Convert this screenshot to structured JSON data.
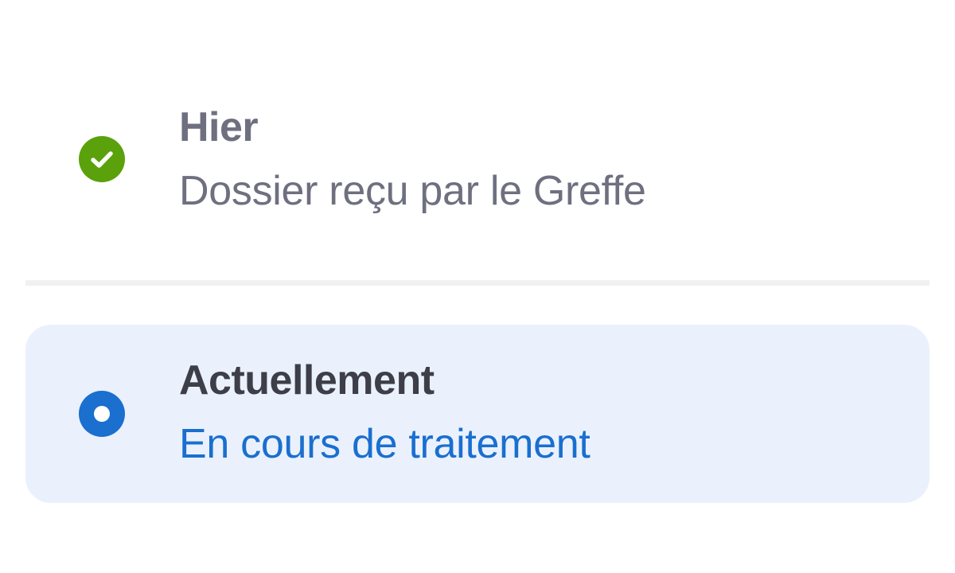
{
  "colors": {
    "done_accent": "#5aa10c",
    "current_accent": "#1a6fcf",
    "current_background": "#eaf1fc",
    "muted_text": "#6e7080",
    "strong_text": "#3d3e48",
    "divider": "#f1f1f3"
  },
  "timeline": {
    "steps": [
      {
        "state": "done",
        "icon": "check-circle-icon",
        "heading": "Hier",
        "detail": "Dossier reçu par le Greffe"
      },
      {
        "state": "current",
        "icon": "radio-dot-icon",
        "heading": "Actuellement",
        "detail": "En cours de traitement"
      }
    ]
  }
}
